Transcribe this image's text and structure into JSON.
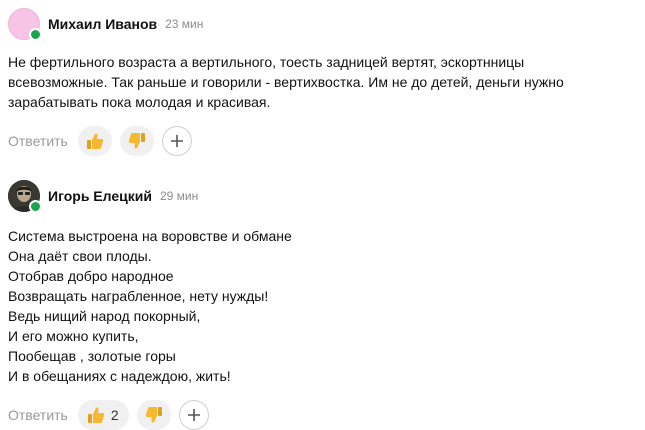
{
  "comments": [
    {
      "author": "Михаил Иванов",
      "time": "23 мин",
      "avatar_color": "#f7c4e6",
      "online": true,
      "text": "Не фертильного возраста а вертильного, тоесть задницей вертят, эскортнницы\nвсевозможные. Так раньше и говорили - вертихвостка. Им не до детей, деньги нужно\nзарабатывать пока молодая и красивая.",
      "reply_label": "Ответить",
      "likes": "",
      "like_icon": "thumbs-up-icon",
      "dislike_icon": "thumbs-down-icon",
      "add_reaction_icon": "plus-icon"
    },
    {
      "author": "Игорь Елецкий",
      "time": "29 мин",
      "online": true,
      "text": "Система выстроена на воровстве и обмане\nОна даёт свои плоды.\nОтобрав добро народное\nВозвращать награбленное, нету нужды!\nВедь нищий народ покорный,\nИ его можно купить,\nПообещав , золотые горы\nИ в обещаниях с надеждою, жить!",
      "reply_label": "Ответить",
      "likes": "2",
      "like_icon": "thumbs-up-icon",
      "dislike_icon": "thumbs-down-icon",
      "add_reaction_icon": "plus-icon"
    }
  ],
  "colors": {
    "online": "#19a64a",
    "muted": "#999999",
    "thumb": "#f5b82e"
  }
}
